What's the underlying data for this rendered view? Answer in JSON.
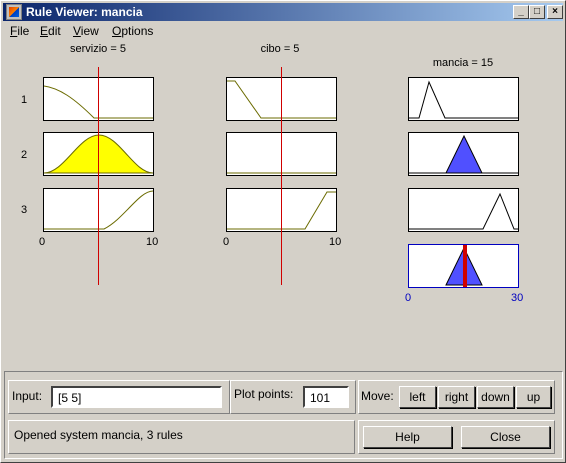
{
  "window": {
    "title": "Rule Viewer: mancia"
  },
  "menu": [
    {
      "key": "F",
      "rest": "ile"
    },
    {
      "key": "E",
      "rest": "dit"
    },
    {
      "key": "V",
      "rest": "iew"
    },
    {
      "key": "O",
      "rest": "ptions"
    }
  ],
  "columns": {
    "servizio": "servizio = 5",
    "cibo": "cibo = 5",
    "mancia": "mancia = 15"
  },
  "rules": [
    "1",
    "2",
    "3"
  ],
  "axes": {
    "servizio_min": "0",
    "servizio_max": "10",
    "cibo_min": "0",
    "cibo_max": "10",
    "mancia_min": "0",
    "mancia_max": "30"
  },
  "colors": {
    "fired_input": "#ffff00",
    "output_fill": "#5050ff",
    "crosshair": "#d00000",
    "output_axis": "#0000c0"
  },
  "input": {
    "label": "Input:",
    "value": "[5 5]"
  },
  "plot_points": {
    "label": "Plot points:",
    "value": "101"
  },
  "move": {
    "label": "Move:",
    "left": "left",
    "right": "right",
    "down": "down",
    "up": "up"
  },
  "status": "Opened system mancia, 3 rules",
  "buttons": {
    "help": "Help",
    "close": "Close"
  }
}
